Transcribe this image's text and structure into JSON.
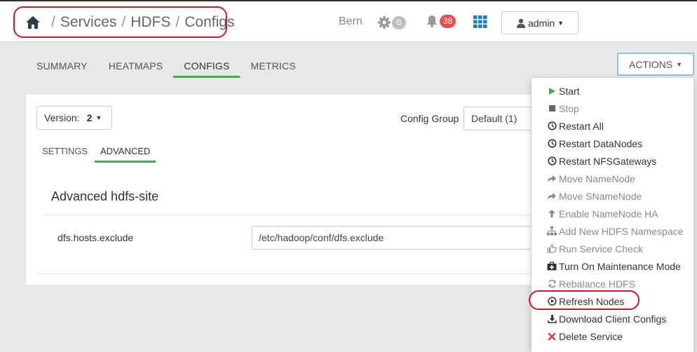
{
  "colors": {
    "accent_green": "#3fae49",
    "annotation_red": "#d0182a",
    "badge_red": "#e5504f",
    "badge_grey": "#bfbfbf",
    "link_blue": "#1b7cc7"
  },
  "topbar": {
    "breadcrumb": [
      "Services",
      "HDFS",
      "Configs"
    ],
    "separator": "/",
    "cluster_name": "Bern",
    "ops_count": "0",
    "alerts_count": "38",
    "user_label": "admin",
    "icons": {
      "home": "home-icon",
      "ops": "gear-icon",
      "alerts": "bell-icon",
      "views": "grid-icon",
      "user": "user-icon"
    }
  },
  "tabs": [
    {
      "label": "SUMMARY",
      "active": false
    },
    {
      "label": "HEATMAPS",
      "active": false
    },
    {
      "label": "CONFIGS",
      "active": true
    },
    {
      "label": "METRICS",
      "active": false
    }
  ],
  "actions_button": "ACTIONS",
  "config": {
    "version_label": "Version:",
    "version_value": "2",
    "config_group_label": "Config Group",
    "config_group_value": "Default (1)",
    "subtabs": [
      {
        "label": "SETTINGS",
        "active": false
      },
      {
        "label": "ADVANCED",
        "active": true
      }
    ],
    "section_title": "Advanced hdfs-site",
    "property_name": "dfs.hosts.exclude",
    "property_value": "/etc/hadoop/conf/dfs.exclude"
  },
  "actions_menu": [
    {
      "label": "Start",
      "icon": "play-icon",
      "enabled": true
    },
    {
      "label": "Stop",
      "icon": "stop-icon",
      "enabled": false
    },
    {
      "label": "Restart All",
      "icon": "clock-icon",
      "enabled": true
    },
    {
      "label": "Restart DataNodes",
      "icon": "clock-icon",
      "enabled": true
    },
    {
      "label": "Restart NFSGateways",
      "icon": "clock-icon",
      "enabled": true
    },
    {
      "label": "Move NameNode",
      "icon": "share-arrow-icon",
      "enabled": false
    },
    {
      "label": "Move SNameNode",
      "icon": "share-arrow-icon",
      "enabled": false
    },
    {
      "label": "Enable NameNode HA",
      "icon": "arrow-up-icon",
      "enabled": false
    },
    {
      "label": "Add New HDFS Namespace",
      "icon": "sitemap-icon",
      "enabled": false
    },
    {
      "label": "Run Service Check",
      "icon": "thumbs-up-icon",
      "enabled": false
    },
    {
      "label": "Turn On Maintenance Mode",
      "icon": "medkit-icon",
      "enabled": true
    },
    {
      "label": "Rebalance HDFS",
      "icon": "refresh-icon",
      "enabled": false
    },
    {
      "label": "Refresh Nodes",
      "icon": "play-circle-icon",
      "enabled": true
    },
    {
      "label": "Download Client Configs",
      "icon": "download-icon",
      "enabled": true
    },
    {
      "label": "Delete Service",
      "icon": "x-icon",
      "enabled": true
    }
  ]
}
